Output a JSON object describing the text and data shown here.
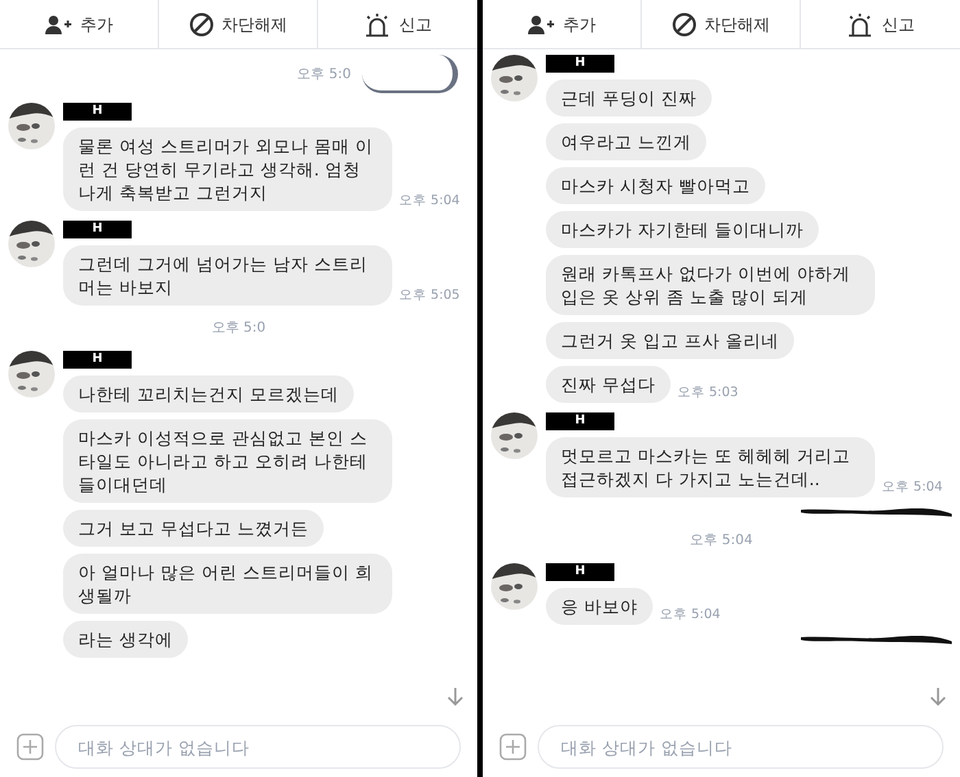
{
  "panels": [
    {
      "toolbar": [
        {
          "kind": "add",
          "label": "추가"
        },
        {
          "kind": "unblock",
          "label": "차단해제"
        },
        {
          "kind": "report",
          "label": "신고"
        }
      ],
      "messages": [
        {
          "kind": "sent_redacted",
          "time": "오후 5:0"
        },
        {
          "kind": "group",
          "name": "H",
          "bubbles": [
            {
              "text": "물론 여성 스트리머가 외모나 몸매 이런 건 당연히 무기라고 생각해. 엄청나게 축복받고 그런거지",
              "time": "오후 5:04"
            }
          ]
        },
        {
          "kind": "group",
          "name": "H",
          "bubbles": [
            {
              "text": "그런데 그거에 넘어가는 남자 스트리머는 바보지",
              "time": "오후 5:05"
            }
          ]
        },
        {
          "kind": "time",
          "time": "오후 5:0"
        },
        {
          "kind": "group",
          "name": "H",
          "bubbles": [
            {
              "text": "나한테 꼬리치는건지 모르겠는데"
            },
            {
              "text": "마스카 이성적으로 관심없고 본인 스타일도 아니라고 하고 오히려 나한테 들이대던데"
            },
            {
              "text": "그거 보고 무섭다고 느꼈거든"
            },
            {
              "text": "아 얼마나 많은 어린 스트리머들이 희생될까"
            },
            {
              "text": "라는 생각에"
            }
          ]
        }
      ],
      "input": {
        "placeholder": "대화 상대가 없습니다"
      }
    },
    {
      "toolbar": [
        {
          "kind": "add",
          "label": "추가"
        },
        {
          "kind": "unblock",
          "label": "차단해제"
        },
        {
          "kind": "report",
          "label": "신고"
        }
      ],
      "messages": [
        {
          "kind": "group",
          "name": "H",
          "bubbles": [
            {
              "text": "근데 푸딩이 진짜"
            },
            {
              "text": "여우라고 느낀게"
            },
            {
              "text": "마스카 시청자 빨아먹고"
            },
            {
              "text": "마스카가 자기한테 들이대니까"
            },
            {
              "text": "원래 카톡프사 없다가 이번에 야하게 입은 옷 상위 좀 노출 많이 되게"
            },
            {
              "text": "그런거 옷 입고 프사 올리네"
            },
            {
              "text": "진짜 무섭다",
              "time": "오후 5:03"
            }
          ]
        },
        {
          "kind": "group",
          "name": "H",
          "bubbles": [
            {
              "text": "멋모르고 마스카는 또 헤헤헤 거리고 접근하겠지 다 가지고 노는건데..",
              "time": "오후 5:04"
            }
          ]
        },
        {
          "kind": "redacted"
        },
        {
          "kind": "time",
          "time": "오후 5:04"
        },
        {
          "kind": "group",
          "name": "H",
          "bubbles": [
            {
              "text": "응 바보야",
              "time": "오후 5:04"
            }
          ]
        },
        {
          "kind": "redacted"
        }
      ],
      "input": {
        "placeholder": "대화 상대가 없습니다"
      }
    }
  ]
}
